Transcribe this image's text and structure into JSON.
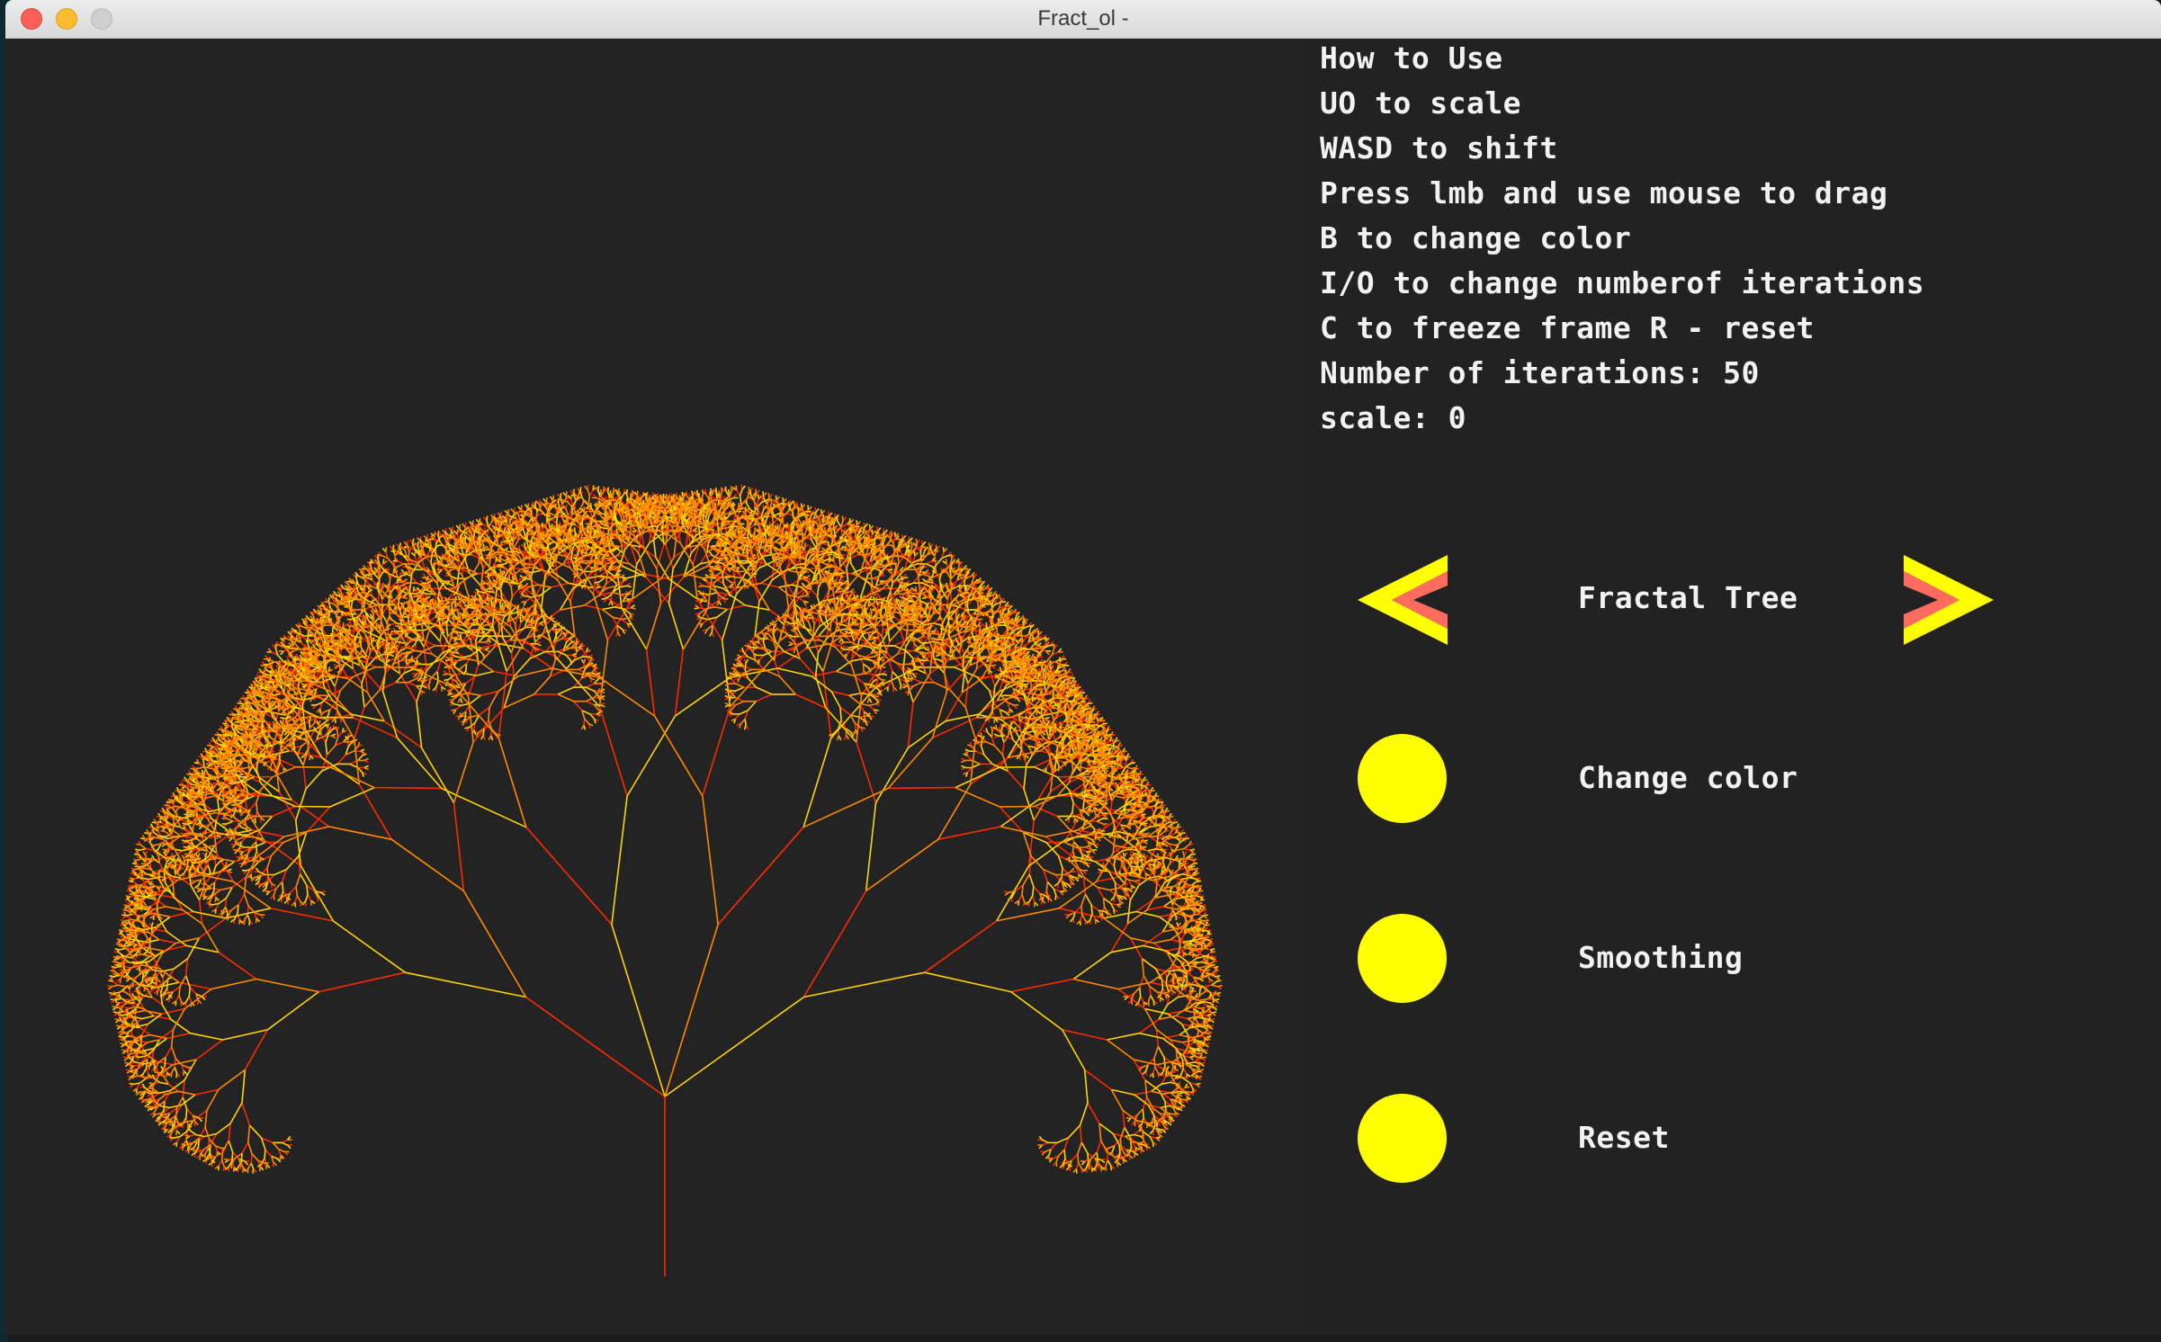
{
  "window": {
    "title": "Fract_ol -"
  },
  "help": {
    "lines": [
      "How to Use",
      "UO to scale",
      "WASD to shift",
      "Press lmb and use mouse to drag",
      "B to change color",
      "I/O to change numberof iterations",
      "C to freeze frame R - reset"
    ],
    "iterations_label": "Number of iterations: 50",
    "scale_label": "scale: 0"
  },
  "menu": {
    "fractal_name": "Fractal Tree",
    "change_color": "Change color",
    "smoothing": "Smoothing",
    "reset": "Reset"
  },
  "colors": {
    "background": "#232323",
    "button": "#ffff00",
    "arrow_inner": "#ff6b5e",
    "branch_a": "#ff2a00",
    "branch_b": "#ffd400",
    "branch_c": "#ff8a00"
  }
}
